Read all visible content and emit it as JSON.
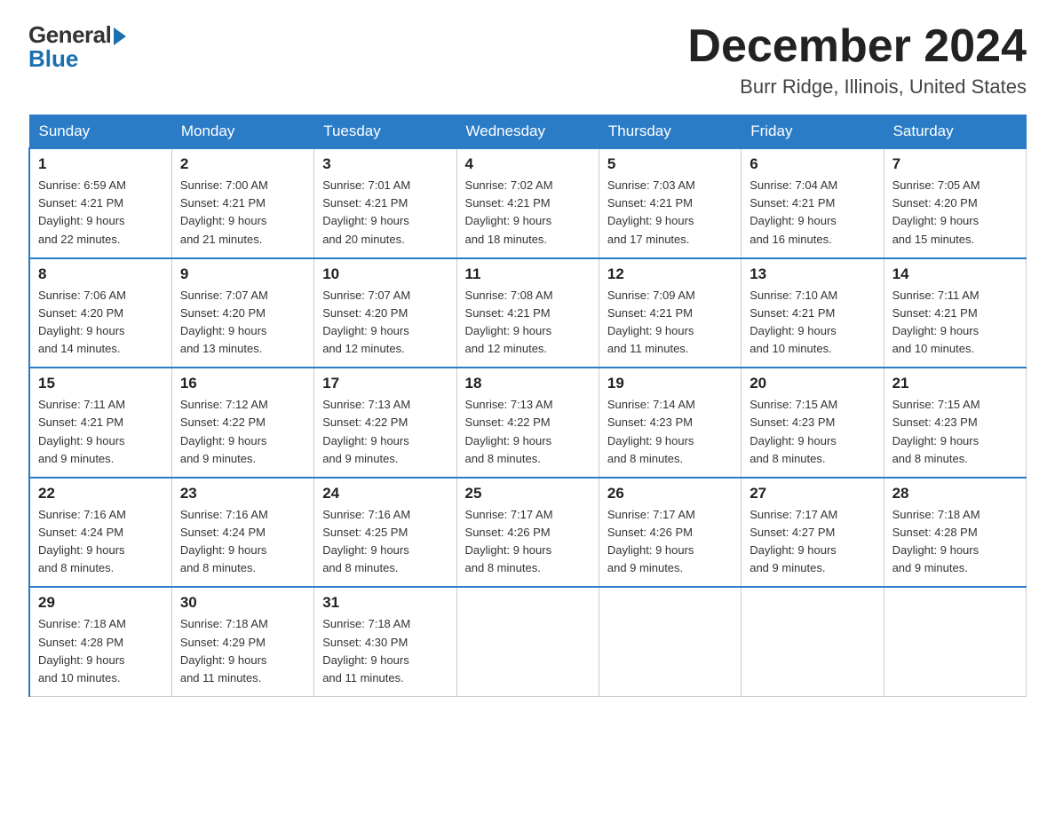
{
  "header": {
    "logo_general": "General",
    "logo_blue": "Blue",
    "month_title": "December 2024",
    "location": "Burr Ridge, Illinois, United States"
  },
  "days_of_week": [
    "Sunday",
    "Monday",
    "Tuesday",
    "Wednesday",
    "Thursday",
    "Friday",
    "Saturday"
  ],
  "weeks": [
    [
      {
        "num": "1",
        "sunrise": "6:59 AM",
        "sunset": "4:21 PM",
        "daylight": "9 hours and 22 minutes."
      },
      {
        "num": "2",
        "sunrise": "7:00 AM",
        "sunset": "4:21 PM",
        "daylight": "9 hours and 21 minutes."
      },
      {
        "num": "3",
        "sunrise": "7:01 AM",
        "sunset": "4:21 PM",
        "daylight": "9 hours and 20 minutes."
      },
      {
        "num": "4",
        "sunrise": "7:02 AM",
        "sunset": "4:21 PM",
        "daylight": "9 hours and 18 minutes."
      },
      {
        "num": "5",
        "sunrise": "7:03 AM",
        "sunset": "4:21 PM",
        "daylight": "9 hours and 17 minutes."
      },
      {
        "num": "6",
        "sunrise": "7:04 AM",
        "sunset": "4:21 PM",
        "daylight": "9 hours and 16 minutes."
      },
      {
        "num": "7",
        "sunrise": "7:05 AM",
        "sunset": "4:20 PM",
        "daylight": "9 hours and 15 minutes."
      }
    ],
    [
      {
        "num": "8",
        "sunrise": "7:06 AM",
        "sunset": "4:20 PM",
        "daylight": "9 hours and 14 minutes."
      },
      {
        "num": "9",
        "sunrise": "7:07 AM",
        "sunset": "4:20 PM",
        "daylight": "9 hours and 13 minutes."
      },
      {
        "num": "10",
        "sunrise": "7:07 AM",
        "sunset": "4:20 PM",
        "daylight": "9 hours and 12 minutes."
      },
      {
        "num": "11",
        "sunrise": "7:08 AM",
        "sunset": "4:21 PM",
        "daylight": "9 hours and 12 minutes."
      },
      {
        "num": "12",
        "sunrise": "7:09 AM",
        "sunset": "4:21 PM",
        "daylight": "9 hours and 11 minutes."
      },
      {
        "num": "13",
        "sunrise": "7:10 AM",
        "sunset": "4:21 PM",
        "daylight": "9 hours and 10 minutes."
      },
      {
        "num": "14",
        "sunrise": "7:11 AM",
        "sunset": "4:21 PM",
        "daylight": "9 hours and 10 minutes."
      }
    ],
    [
      {
        "num": "15",
        "sunrise": "7:11 AM",
        "sunset": "4:21 PM",
        "daylight": "9 hours and 9 minutes."
      },
      {
        "num": "16",
        "sunrise": "7:12 AM",
        "sunset": "4:22 PM",
        "daylight": "9 hours and 9 minutes."
      },
      {
        "num": "17",
        "sunrise": "7:13 AM",
        "sunset": "4:22 PM",
        "daylight": "9 hours and 9 minutes."
      },
      {
        "num": "18",
        "sunrise": "7:13 AM",
        "sunset": "4:22 PM",
        "daylight": "9 hours and 8 minutes."
      },
      {
        "num": "19",
        "sunrise": "7:14 AM",
        "sunset": "4:23 PM",
        "daylight": "9 hours and 8 minutes."
      },
      {
        "num": "20",
        "sunrise": "7:15 AM",
        "sunset": "4:23 PM",
        "daylight": "9 hours and 8 minutes."
      },
      {
        "num": "21",
        "sunrise": "7:15 AM",
        "sunset": "4:23 PM",
        "daylight": "9 hours and 8 minutes."
      }
    ],
    [
      {
        "num": "22",
        "sunrise": "7:16 AM",
        "sunset": "4:24 PM",
        "daylight": "9 hours and 8 minutes."
      },
      {
        "num": "23",
        "sunrise": "7:16 AM",
        "sunset": "4:24 PM",
        "daylight": "9 hours and 8 minutes."
      },
      {
        "num": "24",
        "sunrise": "7:16 AM",
        "sunset": "4:25 PM",
        "daylight": "9 hours and 8 minutes."
      },
      {
        "num": "25",
        "sunrise": "7:17 AM",
        "sunset": "4:26 PM",
        "daylight": "9 hours and 8 minutes."
      },
      {
        "num": "26",
        "sunrise": "7:17 AM",
        "sunset": "4:26 PM",
        "daylight": "9 hours and 9 minutes."
      },
      {
        "num": "27",
        "sunrise": "7:17 AM",
        "sunset": "4:27 PM",
        "daylight": "9 hours and 9 minutes."
      },
      {
        "num": "28",
        "sunrise": "7:18 AM",
        "sunset": "4:28 PM",
        "daylight": "9 hours and 9 minutes."
      }
    ],
    [
      {
        "num": "29",
        "sunrise": "7:18 AM",
        "sunset": "4:28 PM",
        "daylight": "9 hours and 10 minutes."
      },
      {
        "num": "30",
        "sunrise": "7:18 AM",
        "sunset": "4:29 PM",
        "daylight": "9 hours and 11 minutes."
      },
      {
        "num": "31",
        "sunrise": "7:18 AM",
        "sunset": "4:30 PM",
        "daylight": "9 hours and 11 minutes."
      },
      null,
      null,
      null,
      null
    ]
  ],
  "labels": {
    "sunrise": "Sunrise:",
    "sunset": "Sunset:",
    "daylight": "Daylight:"
  }
}
